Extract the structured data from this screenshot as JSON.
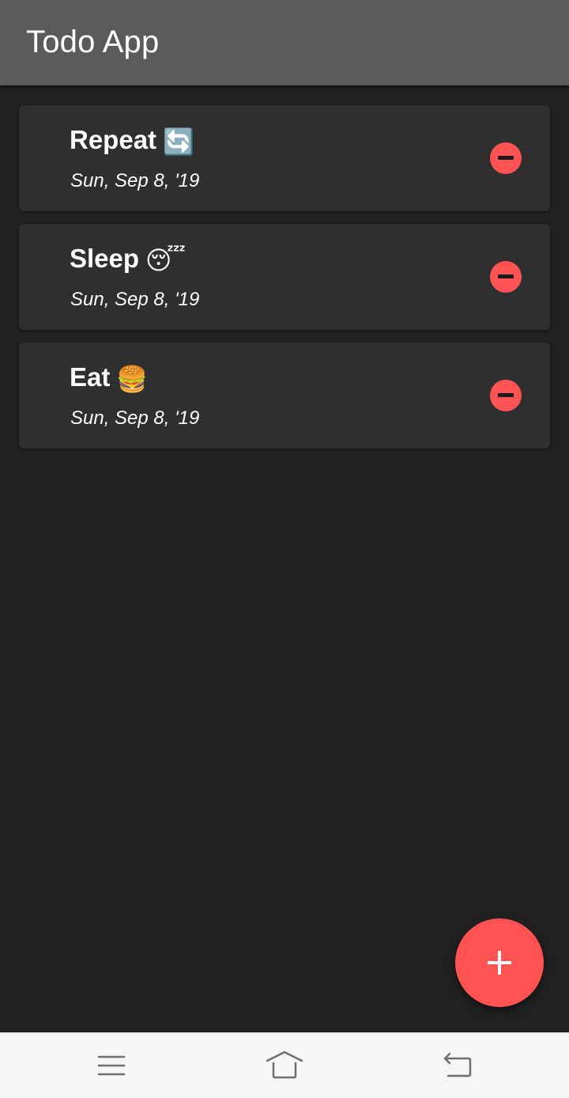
{
  "app": {
    "title": "Todo App"
  },
  "todos": [
    {
      "title": "Repeat",
      "emoji": "🔄",
      "date": "Sun, Sep 8, '19",
      "delete_icon": "minus-circle-icon"
    },
    {
      "title": "Sleep",
      "emoji": "😴",
      "date": "Sun, Sep 8, '19",
      "delete_icon": "minus-circle-icon"
    },
    {
      "title": "Eat",
      "emoji": "🍔",
      "date": "Sun, Sep 8, '19",
      "delete_icon": "minus-circle-icon"
    }
  ],
  "fab": {
    "icon": "plus-icon"
  },
  "system_nav": {
    "menu_icon": "menu-icon",
    "home_icon": "home-icon",
    "back_icon": "back-icon"
  },
  "colors": {
    "appbar": "#5b5b5b",
    "background": "#212121",
    "card": "#2f2f2f",
    "accent": "#ff5252",
    "navbar": "#f6f6f6"
  }
}
